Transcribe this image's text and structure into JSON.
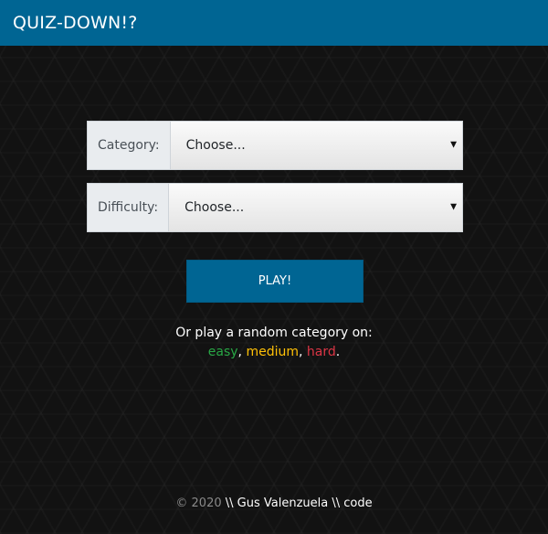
{
  "app": {
    "title": "QUIZ-DOWN!?"
  },
  "form": {
    "category": {
      "label": "Category:",
      "selected": "Choose..."
    },
    "difficulty": {
      "label": "Difficulty:",
      "selected": "Choose..."
    },
    "play_label": "PLAY!"
  },
  "random": {
    "text": "Or play a random category on:",
    "easy": "easy",
    "medium": "medium",
    "hard": "hard",
    "sep1": ", ",
    "sep2": ", ",
    "end": "."
  },
  "footer": {
    "copyright": "© 2020",
    "author": "\\\\ Gus Valenzuela \\\\ code"
  },
  "icons": {
    "select_caret": "caret-down-icon"
  },
  "colors": {
    "brand": "#006593",
    "easy": "#28a745",
    "medium": "#ffc107",
    "hard": "#dc3545"
  }
}
